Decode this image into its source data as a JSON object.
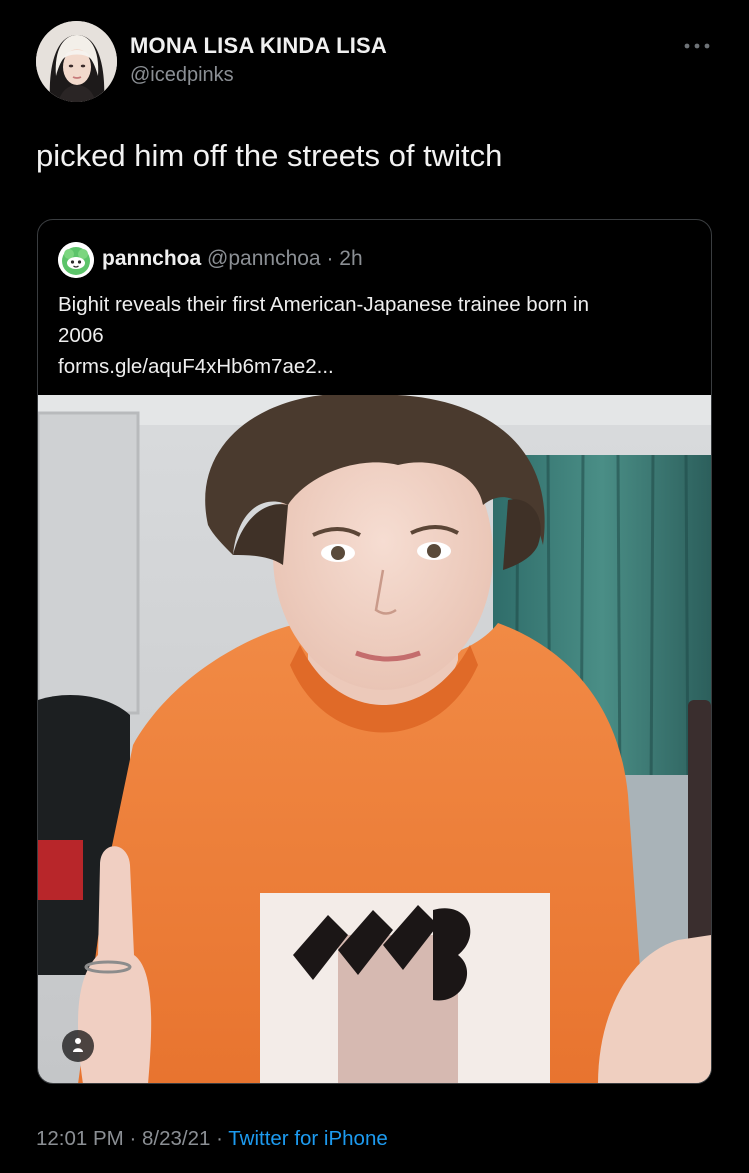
{
  "author": {
    "name": "MONA LISA KINDA LISA",
    "handle": "@icedpinks"
  },
  "tweet": {
    "text": "picked him off the streets of twitch"
  },
  "quote": {
    "name": "pannchoa",
    "handle": "@pannchoa",
    "separator": "·",
    "time": "2h",
    "text_line1": "Bighit reveals their first American-Japanese trainee born in",
    "text_line2": "2006",
    "link": "forms.gle/aquF4xHb6m7ae2..."
  },
  "meta": {
    "time": "12:01 PM",
    "separator": "·",
    "date": "8/23/21",
    "source": "Twitter for iPhone"
  },
  "icons": {
    "more": "more-horizontal-icon",
    "alt": "person-icon"
  },
  "colors": {
    "background": "#000000",
    "link": "#1d9bf0",
    "secondary_text": "#8b8f94"
  }
}
